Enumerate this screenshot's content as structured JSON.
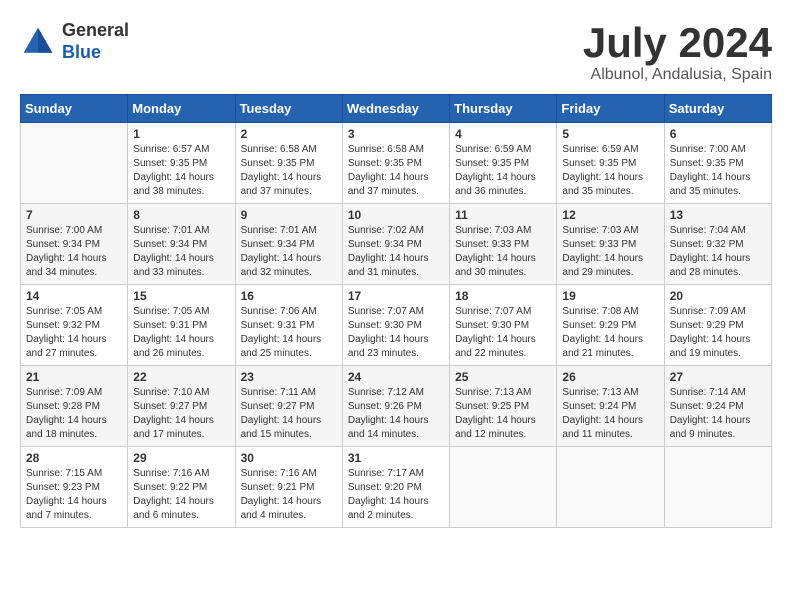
{
  "header": {
    "logo_line1": "General",
    "logo_line2": "Blue",
    "month": "July 2024",
    "location": "Albunol, Andalusia, Spain"
  },
  "weekdays": [
    "Sunday",
    "Monday",
    "Tuesday",
    "Wednesday",
    "Thursday",
    "Friday",
    "Saturday"
  ],
  "weeks": [
    [
      {
        "day": "",
        "sunrise": "",
        "sunset": "",
        "daylight": ""
      },
      {
        "day": "1",
        "sunrise": "Sunrise: 6:57 AM",
        "sunset": "Sunset: 9:35 PM",
        "daylight": "Daylight: 14 hours and 38 minutes."
      },
      {
        "day": "2",
        "sunrise": "Sunrise: 6:58 AM",
        "sunset": "Sunset: 9:35 PM",
        "daylight": "Daylight: 14 hours and 37 minutes."
      },
      {
        "day": "3",
        "sunrise": "Sunrise: 6:58 AM",
        "sunset": "Sunset: 9:35 PM",
        "daylight": "Daylight: 14 hours and 37 minutes."
      },
      {
        "day": "4",
        "sunrise": "Sunrise: 6:59 AM",
        "sunset": "Sunset: 9:35 PM",
        "daylight": "Daylight: 14 hours and 36 minutes."
      },
      {
        "day": "5",
        "sunrise": "Sunrise: 6:59 AM",
        "sunset": "Sunset: 9:35 PM",
        "daylight": "Daylight: 14 hours and 35 minutes."
      },
      {
        "day": "6",
        "sunrise": "Sunrise: 7:00 AM",
        "sunset": "Sunset: 9:35 PM",
        "daylight": "Daylight: 14 hours and 35 minutes."
      }
    ],
    [
      {
        "day": "7",
        "sunrise": "Sunrise: 7:00 AM",
        "sunset": "Sunset: 9:34 PM",
        "daylight": "Daylight: 14 hours and 34 minutes."
      },
      {
        "day": "8",
        "sunrise": "Sunrise: 7:01 AM",
        "sunset": "Sunset: 9:34 PM",
        "daylight": "Daylight: 14 hours and 33 minutes."
      },
      {
        "day": "9",
        "sunrise": "Sunrise: 7:01 AM",
        "sunset": "Sunset: 9:34 PM",
        "daylight": "Daylight: 14 hours and 32 minutes."
      },
      {
        "day": "10",
        "sunrise": "Sunrise: 7:02 AM",
        "sunset": "Sunset: 9:34 PM",
        "daylight": "Daylight: 14 hours and 31 minutes."
      },
      {
        "day": "11",
        "sunrise": "Sunrise: 7:03 AM",
        "sunset": "Sunset: 9:33 PM",
        "daylight": "Daylight: 14 hours and 30 minutes."
      },
      {
        "day": "12",
        "sunrise": "Sunrise: 7:03 AM",
        "sunset": "Sunset: 9:33 PM",
        "daylight": "Daylight: 14 hours and 29 minutes."
      },
      {
        "day": "13",
        "sunrise": "Sunrise: 7:04 AM",
        "sunset": "Sunset: 9:32 PM",
        "daylight": "Daylight: 14 hours and 28 minutes."
      }
    ],
    [
      {
        "day": "14",
        "sunrise": "Sunrise: 7:05 AM",
        "sunset": "Sunset: 9:32 PM",
        "daylight": "Daylight: 14 hours and 27 minutes."
      },
      {
        "day": "15",
        "sunrise": "Sunrise: 7:05 AM",
        "sunset": "Sunset: 9:31 PM",
        "daylight": "Daylight: 14 hours and 26 minutes."
      },
      {
        "day": "16",
        "sunrise": "Sunrise: 7:06 AM",
        "sunset": "Sunset: 9:31 PM",
        "daylight": "Daylight: 14 hours and 25 minutes."
      },
      {
        "day": "17",
        "sunrise": "Sunrise: 7:07 AM",
        "sunset": "Sunset: 9:30 PM",
        "daylight": "Daylight: 14 hours and 23 minutes."
      },
      {
        "day": "18",
        "sunrise": "Sunrise: 7:07 AM",
        "sunset": "Sunset: 9:30 PM",
        "daylight": "Daylight: 14 hours and 22 minutes."
      },
      {
        "day": "19",
        "sunrise": "Sunrise: 7:08 AM",
        "sunset": "Sunset: 9:29 PM",
        "daylight": "Daylight: 14 hours and 21 minutes."
      },
      {
        "day": "20",
        "sunrise": "Sunrise: 7:09 AM",
        "sunset": "Sunset: 9:29 PM",
        "daylight": "Daylight: 14 hours and 19 minutes."
      }
    ],
    [
      {
        "day": "21",
        "sunrise": "Sunrise: 7:09 AM",
        "sunset": "Sunset: 9:28 PM",
        "daylight": "Daylight: 14 hours and 18 minutes."
      },
      {
        "day": "22",
        "sunrise": "Sunrise: 7:10 AM",
        "sunset": "Sunset: 9:27 PM",
        "daylight": "Daylight: 14 hours and 17 minutes."
      },
      {
        "day": "23",
        "sunrise": "Sunrise: 7:11 AM",
        "sunset": "Sunset: 9:27 PM",
        "daylight": "Daylight: 14 hours and 15 minutes."
      },
      {
        "day": "24",
        "sunrise": "Sunrise: 7:12 AM",
        "sunset": "Sunset: 9:26 PM",
        "daylight": "Daylight: 14 hours and 14 minutes."
      },
      {
        "day": "25",
        "sunrise": "Sunrise: 7:13 AM",
        "sunset": "Sunset: 9:25 PM",
        "daylight": "Daylight: 14 hours and 12 minutes."
      },
      {
        "day": "26",
        "sunrise": "Sunrise: 7:13 AM",
        "sunset": "Sunset: 9:24 PM",
        "daylight": "Daylight: 14 hours and 11 minutes."
      },
      {
        "day": "27",
        "sunrise": "Sunrise: 7:14 AM",
        "sunset": "Sunset: 9:24 PM",
        "daylight": "Daylight: 14 hours and 9 minutes."
      }
    ],
    [
      {
        "day": "28",
        "sunrise": "Sunrise: 7:15 AM",
        "sunset": "Sunset: 9:23 PM",
        "daylight": "Daylight: 14 hours and 7 minutes."
      },
      {
        "day": "29",
        "sunrise": "Sunrise: 7:16 AM",
        "sunset": "Sunset: 9:22 PM",
        "daylight": "Daylight: 14 hours and 6 minutes."
      },
      {
        "day": "30",
        "sunrise": "Sunrise: 7:16 AM",
        "sunset": "Sunset: 9:21 PM",
        "daylight": "Daylight: 14 hours and 4 minutes."
      },
      {
        "day": "31",
        "sunrise": "Sunrise: 7:17 AM",
        "sunset": "Sunset: 9:20 PM",
        "daylight": "Daylight: 14 hours and 2 minutes."
      },
      {
        "day": "",
        "sunrise": "",
        "sunset": "",
        "daylight": ""
      },
      {
        "day": "",
        "sunrise": "",
        "sunset": "",
        "daylight": ""
      },
      {
        "day": "",
        "sunrise": "",
        "sunset": "",
        "daylight": ""
      }
    ]
  ]
}
